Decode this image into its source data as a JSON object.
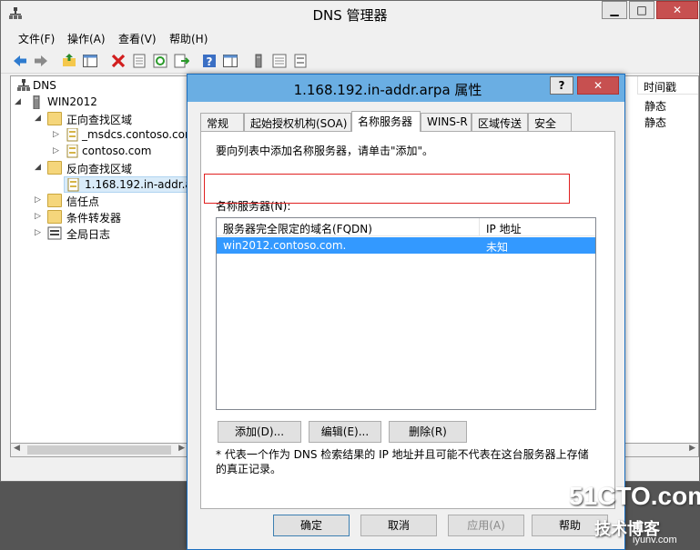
{
  "window": {
    "title": "DNS 管理器",
    "minimize": "▁",
    "maximize": "□",
    "close": "✕"
  },
  "menu": [
    "文件(F)",
    "操作(A)",
    "查看(V)",
    "帮助(H)"
  ],
  "tree": {
    "nodes": [
      {
        "label": "DNS"
      },
      {
        "label": "WIN2012"
      },
      {
        "label": "正向查找区域"
      },
      {
        "label": "_msdcs.contoso.com"
      },
      {
        "label": "contoso.com"
      },
      {
        "label": "反向查找区域"
      },
      {
        "label": "1.168.192.in-addr.arpa"
      },
      {
        "label": "信任点"
      },
      {
        "label": "条件转发器"
      },
      {
        "label": "全局日志"
      }
    ]
  },
  "right": {
    "header": "时间戳",
    "cells": [
      "静态",
      "静态"
    ]
  },
  "dialog": {
    "title": "1.168.192.in-addr.arpa 属性",
    "help": "?",
    "close": "✕",
    "tabs": [
      "常规",
      "起始授权机构(SOA)",
      "名称服务器",
      "WINS-R",
      "区域传送",
      "安全"
    ],
    "instruction": "要向列表中添加名称服务器，请单击\"添加\"。",
    "ns_label": "名称服务器(N):",
    "columns": [
      "服务器完全限定的域名(FQDN)",
      "IP 地址"
    ],
    "rows": [
      {
        "fqdn": "win2012.contoso.com.",
        "ip": "未知"
      }
    ],
    "add": "添加(D)...",
    "edit": "编辑(E)...",
    "remove": "删除(R)",
    "footnote": "* 代表一个作为 DNS 检索结果的 IP 地址并且可能不代表在这台服务器上存储的真正记录。",
    "ok": "确定",
    "cancel": "取消",
    "apply": "应用(A)",
    "help_btn": "帮助"
  },
  "watermark": {
    "site": "51CTO.com",
    "text": "技术博客",
    "url": "iyunv.com"
  }
}
